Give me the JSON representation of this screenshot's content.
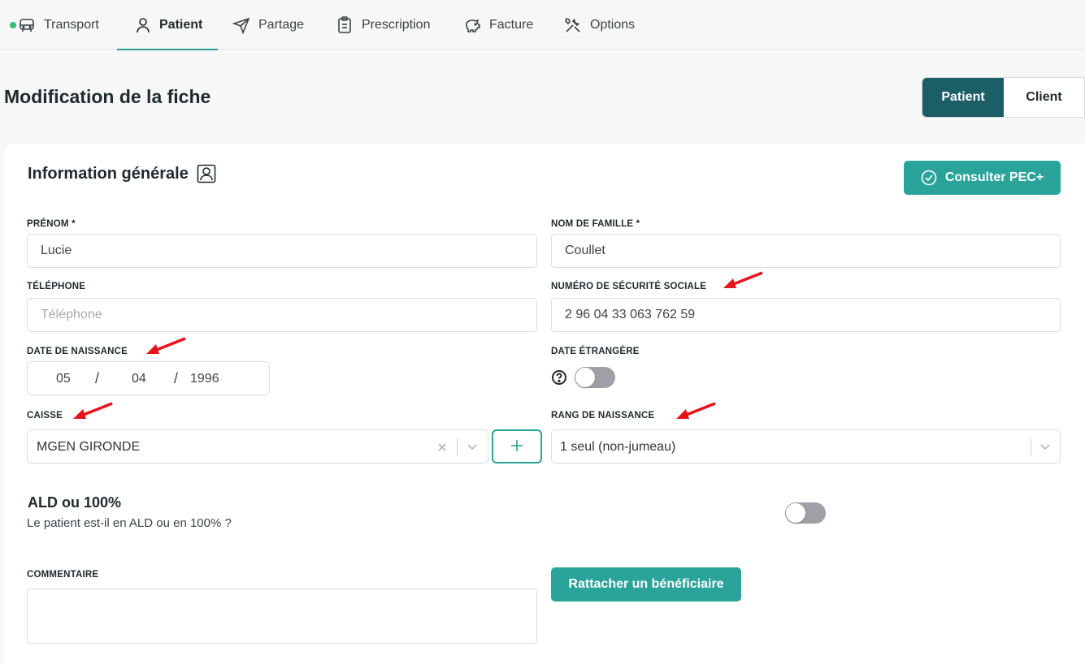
{
  "tabs": [
    {
      "label": "Transport",
      "icon": "car-icon",
      "status_dot_color": "#2fbf71"
    },
    {
      "label": "Patient",
      "icon": "user-icon",
      "active": true
    },
    {
      "label": "Partage",
      "icon": "send-icon"
    },
    {
      "label": "Prescription",
      "icon": "clipboard-icon"
    },
    {
      "label": "Facture",
      "icon": "piggy-bank-icon"
    },
    {
      "label": "Options",
      "icon": "tools-icon"
    }
  ],
  "header": {
    "title": "Modification de la fiche",
    "toggle_patient": "Patient",
    "toggle_client": "Client",
    "selected": "Patient"
  },
  "section": {
    "title": "Information générale",
    "pec_button": "Consulter PEC+"
  },
  "form": {
    "prenom": {
      "label": "PRÉNOM *",
      "value": "Lucie"
    },
    "nom": {
      "label": "NOM DE FAMILLE *",
      "value": "Coullet"
    },
    "telephone": {
      "label": "TÉLÉPHONE",
      "value": "",
      "placeholder": "Téléphone"
    },
    "secu": {
      "label": "NUMÉRO DE SÉCURITÉ SOCIALE",
      "value": "2 96 04 33 063 762 59"
    },
    "naissance": {
      "label": "DATE DE NAISSANCE",
      "day": "05",
      "month": "04",
      "year": "1996",
      "separator": "/"
    },
    "date_etrangere": {
      "label": "DATE ÉTRANGÈRE",
      "enabled": false
    },
    "caisse": {
      "label": "CAISSE",
      "value": "MGEN GIRONDE"
    },
    "rang": {
      "label": "RANG DE NAISSANCE",
      "value": "1 seul (non-jumeau)"
    },
    "ald": {
      "title": "ALD ou 100%",
      "question": "Le patient est-il en ALD ou en 100% ?",
      "enabled": false
    },
    "commentaire": {
      "label": "COMMENTAIRE",
      "value": ""
    },
    "rattacher_button": "Rattacher un bénéficiaire"
  },
  "colors": {
    "accent": "#2aa39a",
    "dark_teal": "#1b5e66",
    "annotation_arrow": "#e8141c"
  }
}
